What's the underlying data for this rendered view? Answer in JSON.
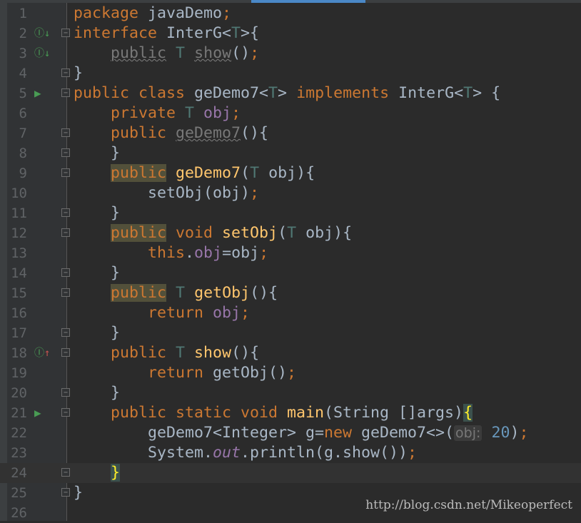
{
  "editor": {
    "current_line": 24,
    "colors": {
      "background": "#2b2b2b",
      "keyword": "#cc7832",
      "text": "#a9b7c6",
      "type_param": "#507874",
      "field": "#9876aa",
      "method": "#ffc66d",
      "number": "#6897bb"
    },
    "lines": [
      {
        "n": "1",
        "g": "",
        "fold": false,
        "t": [
          [
            "package ",
            "kw"
          ],
          [
            "javaDemo",
            ""
          ],
          [
            ";",
            "kw"
          ]
        ]
      },
      {
        "n": "2",
        "g": "implemented-down-icon",
        "fold": true,
        "t": [
          [
            "interface ",
            "kw"
          ],
          [
            "InterG<",
            ""
          ],
          [
            "T",
            "tp"
          ],
          [
            ">{",
            ""
          ]
        ]
      },
      {
        "n": "3",
        "g": "implemented-down-icon",
        "fold": false,
        "t": [
          [
            "    ",
            ""
          ],
          [
            "public",
            "kw dim un"
          ],
          [
            " ",
            ""
          ],
          [
            "T",
            "tp"
          ],
          [
            " ",
            ""
          ],
          [
            "show",
            "dim un"
          ],
          [
            "()",
            ""
          ],
          [
            ";",
            "kw"
          ]
        ]
      },
      {
        "n": "4",
        "g": "",
        "fold": true,
        "t": [
          [
            "}",
            ""
          ]
        ]
      },
      {
        "n": "5",
        "g": "run-icon",
        "fold": true,
        "t": [
          [
            "public class ",
            "kw"
          ],
          [
            "geDemo7<",
            ""
          ],
          [
            "T",
            "tp"
          ],
          [
            "> ",
            ""
          ],
          [
            "implements ",
            "kw"
          ],
          [
            "InterG<",
            ""
          ],
          [
            "T",
            "tp"
          ],
          [
            "> {",
            ""
          ]
        ]
      },
      {
        "n": "6",
        "g": "",
        "fold": false,
        "t": [
          [
            "    ",
            ""
          ],
          [
            "private ",
            "kw"
          ],
          [
            "T ",
            "tp"
          ],
          [
            "obj",
            "fd"
          ],
          [
            ";",
            "kw"
          ]
        ]
      },
      {
        "n": "7",
        "g": "",
        "fold": true,
        "t": [
          [
            "    ",
            ""
          ],
          [
            "public ",
            "kw"
          ],
          [
            "geDemo7",
            "dim un"
          ],
          [
            "(){",
            ""
          ]
        ]
      },
      {
        "n": "8",
        "g": "",
        "fold": true,
        "t": [
          [
            "    }",
            ""
          ]
        ]
      },
      {
        "n": "9",
        "g": "",
        "fold": true,
        "t": [
          [
            "    ",
            ""
          ],
          [
            "public",
            "kw hl"
          ],
          [
            " ",
            ""
          ],
          [
            "geDemo7",
            "md"
          ],
          [
            "(",
            ""
          ],
          [
            "T",
            "tp"
          ],
          [
            " obj){",
            ""
          ]
        ]
      },
      {
        "n": "10",
        "g": "",
        "fold": false,
        "t": [
          [
            "        setObj(obj)",
            ""
          ],
          [
            ";",
            "kw"
          ]
        ]
      },
      {
        "n": "11",
        "g": "",
        "fold": true,
        "t": [
          [
            "    }",
            ""
          ]
        ]
      },
      {
        "n": "12",
        "g": "",
        "fold": true,
        "t": [
          [
            "    ",
            ""
          ],
          [
            "public",
            "kw hl"
          ],
          [
            " void ",
            "kw"
          ],
          [
            "setObj",
            "md"
          ],
          [
            "(",
            ""
          ],
          [
            "T",
            "tp"
          ],
          [
            " obj){",
            ""
          ]
        ]
      },
      {
        "n": "13",
        "g": "",
        "fold": false,
        "t": [
          [
            "        ",
            ""
          ],
          [
            "this",
            "kw"
          ],
          [
            ".",
            ""
          ],
          [
            "obj",
            "fd"
          ],
          [
            "=obj",
            ""
          ],
          [
            ";",
            "kw"
          ]
        ]
      },
      {
        "n": "14",
        "g": "",
        "fold": true,
        "t": [
          [
            "    }",
            ""
          ]
        ]
      },
      {
        "n": "15",
        "g": "",
        "fold": true,
        "t": [
          [
            "    ",
            ""
          ],
          [
            "public",
            "kw hl"
          ],
          [
            " ",
            ""
          ],
          [
            "T ",
            "tp"
          ],
          [
            "getObj",
            "md"
          ],
          [
            "(){",
            ""
          ]
        ]
      },
      {
        "n": "16",
        "g": "",
        "fold": false,
        "t": [
          [
            "        ",
            ""
          ],
          [
            "return ",
            "kw"
          ],
          [
            "obj",
            "fd"
          ],
          [
            ";",
            "kw"
          ]
        ]
      },
      {
        "n": "17",
        "g": "",
        "fold": true,
        "t": [
          [
            "    }",
            ""
          ]
        ]
      },
      {
        "n": "18",
        "g": "implementing-up-icon",
        "fold": true,
        "t": [
          [
            "    ",
            ""
          ],
          [
            "public ",
            "kw"
          ],
          [
            "T ",
            "tp"
          ],
          [
            "show",
            "md"
          ],
          [
            "(){",
            ""
          ]
        ]
      },
      {
        "n": "19",
        "g": "",
        "fold": false,
        "t": [
          [
            "        ",
            ""
          ],
          [
            "return ",
            "kw"
          ],
          [
            "getObj()",
            ""
          ],
          [
            ";",
            "kw"
          ]
        ]
      },
      {
        "n": "20",
        "g": "",
        "fold": true,
        "t": [
          [
            "    }",
            ""
          ]
        ]
      },
      {
        "n": "21",
        "g": "run-icon",
        "fold": true,
        "t": [
          [
            "    ",
            ""
          ],
          [
            "public static void ",
            "kw"
          ],
          [
            "main",
            "md"
          ],
          [
            "(String []args)",
            ""
          ],
          [
            "{",
            "br"
          ]
        ]
      },
      {
        "n": "22",
        "g": "",
        "fold": false,
        "t": [
          [
            "        geDemo7<Integer> g=",
            ""
          ],
          [
            "new ",
            "kw"
          ],
          [
            "geDemo7<>(",
            ""
          ],
          [
            "obj:",
            "hint"
          ],
          [
            " ",
            ""
          ],
          [
            "20",
            "num"
          ],
          [
            ")",
            ""
          ],
          [
            ";",
            "kw"
          ]
        ]
      },
      {
        "n": "23",
        "g": "",
        "fold": false,
        "t": [
          [
            "        System.",
            ""
          ],
          [
            "out",
            "st"
          ],
          [
            ".println(g.show())",
            ""
          ],
          [
            ";",
            "kw"
          ]
        ]
      },
      {
        "n": "24",
        "g": "",
        "fold": true,
        "t": [
          [
            "    ",
            ""
          ],
          [
            "}",
            "br"
          ]
        ]
      },
      {
        "n": "25",
        "g": "",
        "fold": true,
        "t": [
          [
            "}",
            ""
          ]
        ]
      },
      {
        "n": "26",
        "g": "",
        "fold": false,
        "t": []
      }
    ]
  },
  "watermark": "http://blog.csdn.net/Mikeoperfect"
}
